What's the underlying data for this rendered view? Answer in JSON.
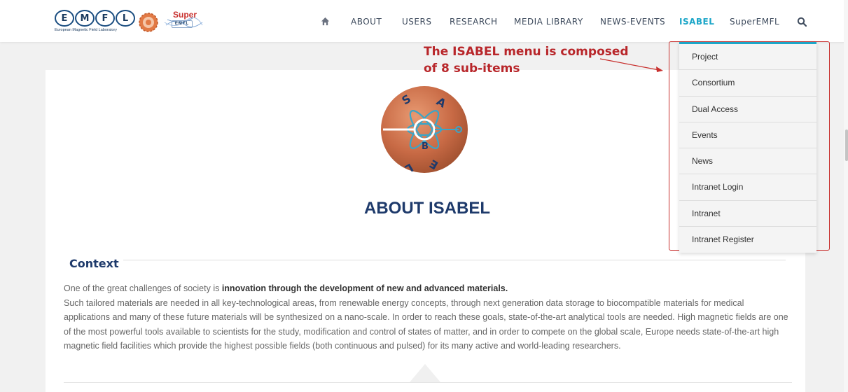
{
  "brand": {
    "emfl_letters": [
      "E",
      "M",
      "F",
      "L"
    ],
    "emfl_tagline": "European Magnetic Field Laboratory",
    "super_word": "Super",
    "super_box": "EMFL"
  },
  "nav": {
    "items": [
      "ABOUT",
      "USERS",
      "RESEARCH",
      "MEDIA LIBRARY",
      "NEWS-EVENTS",
      "ISABEL",
      "SuperEMFL"
    ],
    "active": "ISABEL"
  },
  "annotation": {
    "line1": "The ISABEL menu is composed",
    "line2": "of 8 sub-items"
  },
  "dropdown": {
    "items": [
      "Project",
      "Consortium",
      "Dual Access",
      "Events",
      "News",
      "Intranet Login",
      "Intranet",
      "Intranet Register"
    ]
  },
  "logo_letters": [
    "S",
    "A",
    "B",
    "E",
    "L"
  ],
  "page_title": "ABOUT ISABEL",
  "context": {
    "heading": "Context",
    "intro": "One of the great challenges of society is ",
    "intro_bold": "innovation through the development of new and advanced materials.",
    "body": "Such tailored materials are needed in all key-technological areas, from renewable energy concepts, through next generation data storage to biocompatible materials for medical applications and many of these future materials will be synthesized on a nano-scale. In order to reach these goals, state-of-the-art analytical tools are needed. High magnetic fields are one of the most powerful tools available to scientists for the study, modification and control of states of matter, and in order to compete on the global scale, Europe needs state-of-the-art high magnetic field facilities which provide the highest possible fields (both continuous and pulsed) for its many active and world-leading researchers."
  },
  "colors": {
    "accent": "#1ca6c8",
    "title": "#1e3a6b",
    "annotation": "#b8262a",
    "logo_copper": "#c86a45"
  }
}
